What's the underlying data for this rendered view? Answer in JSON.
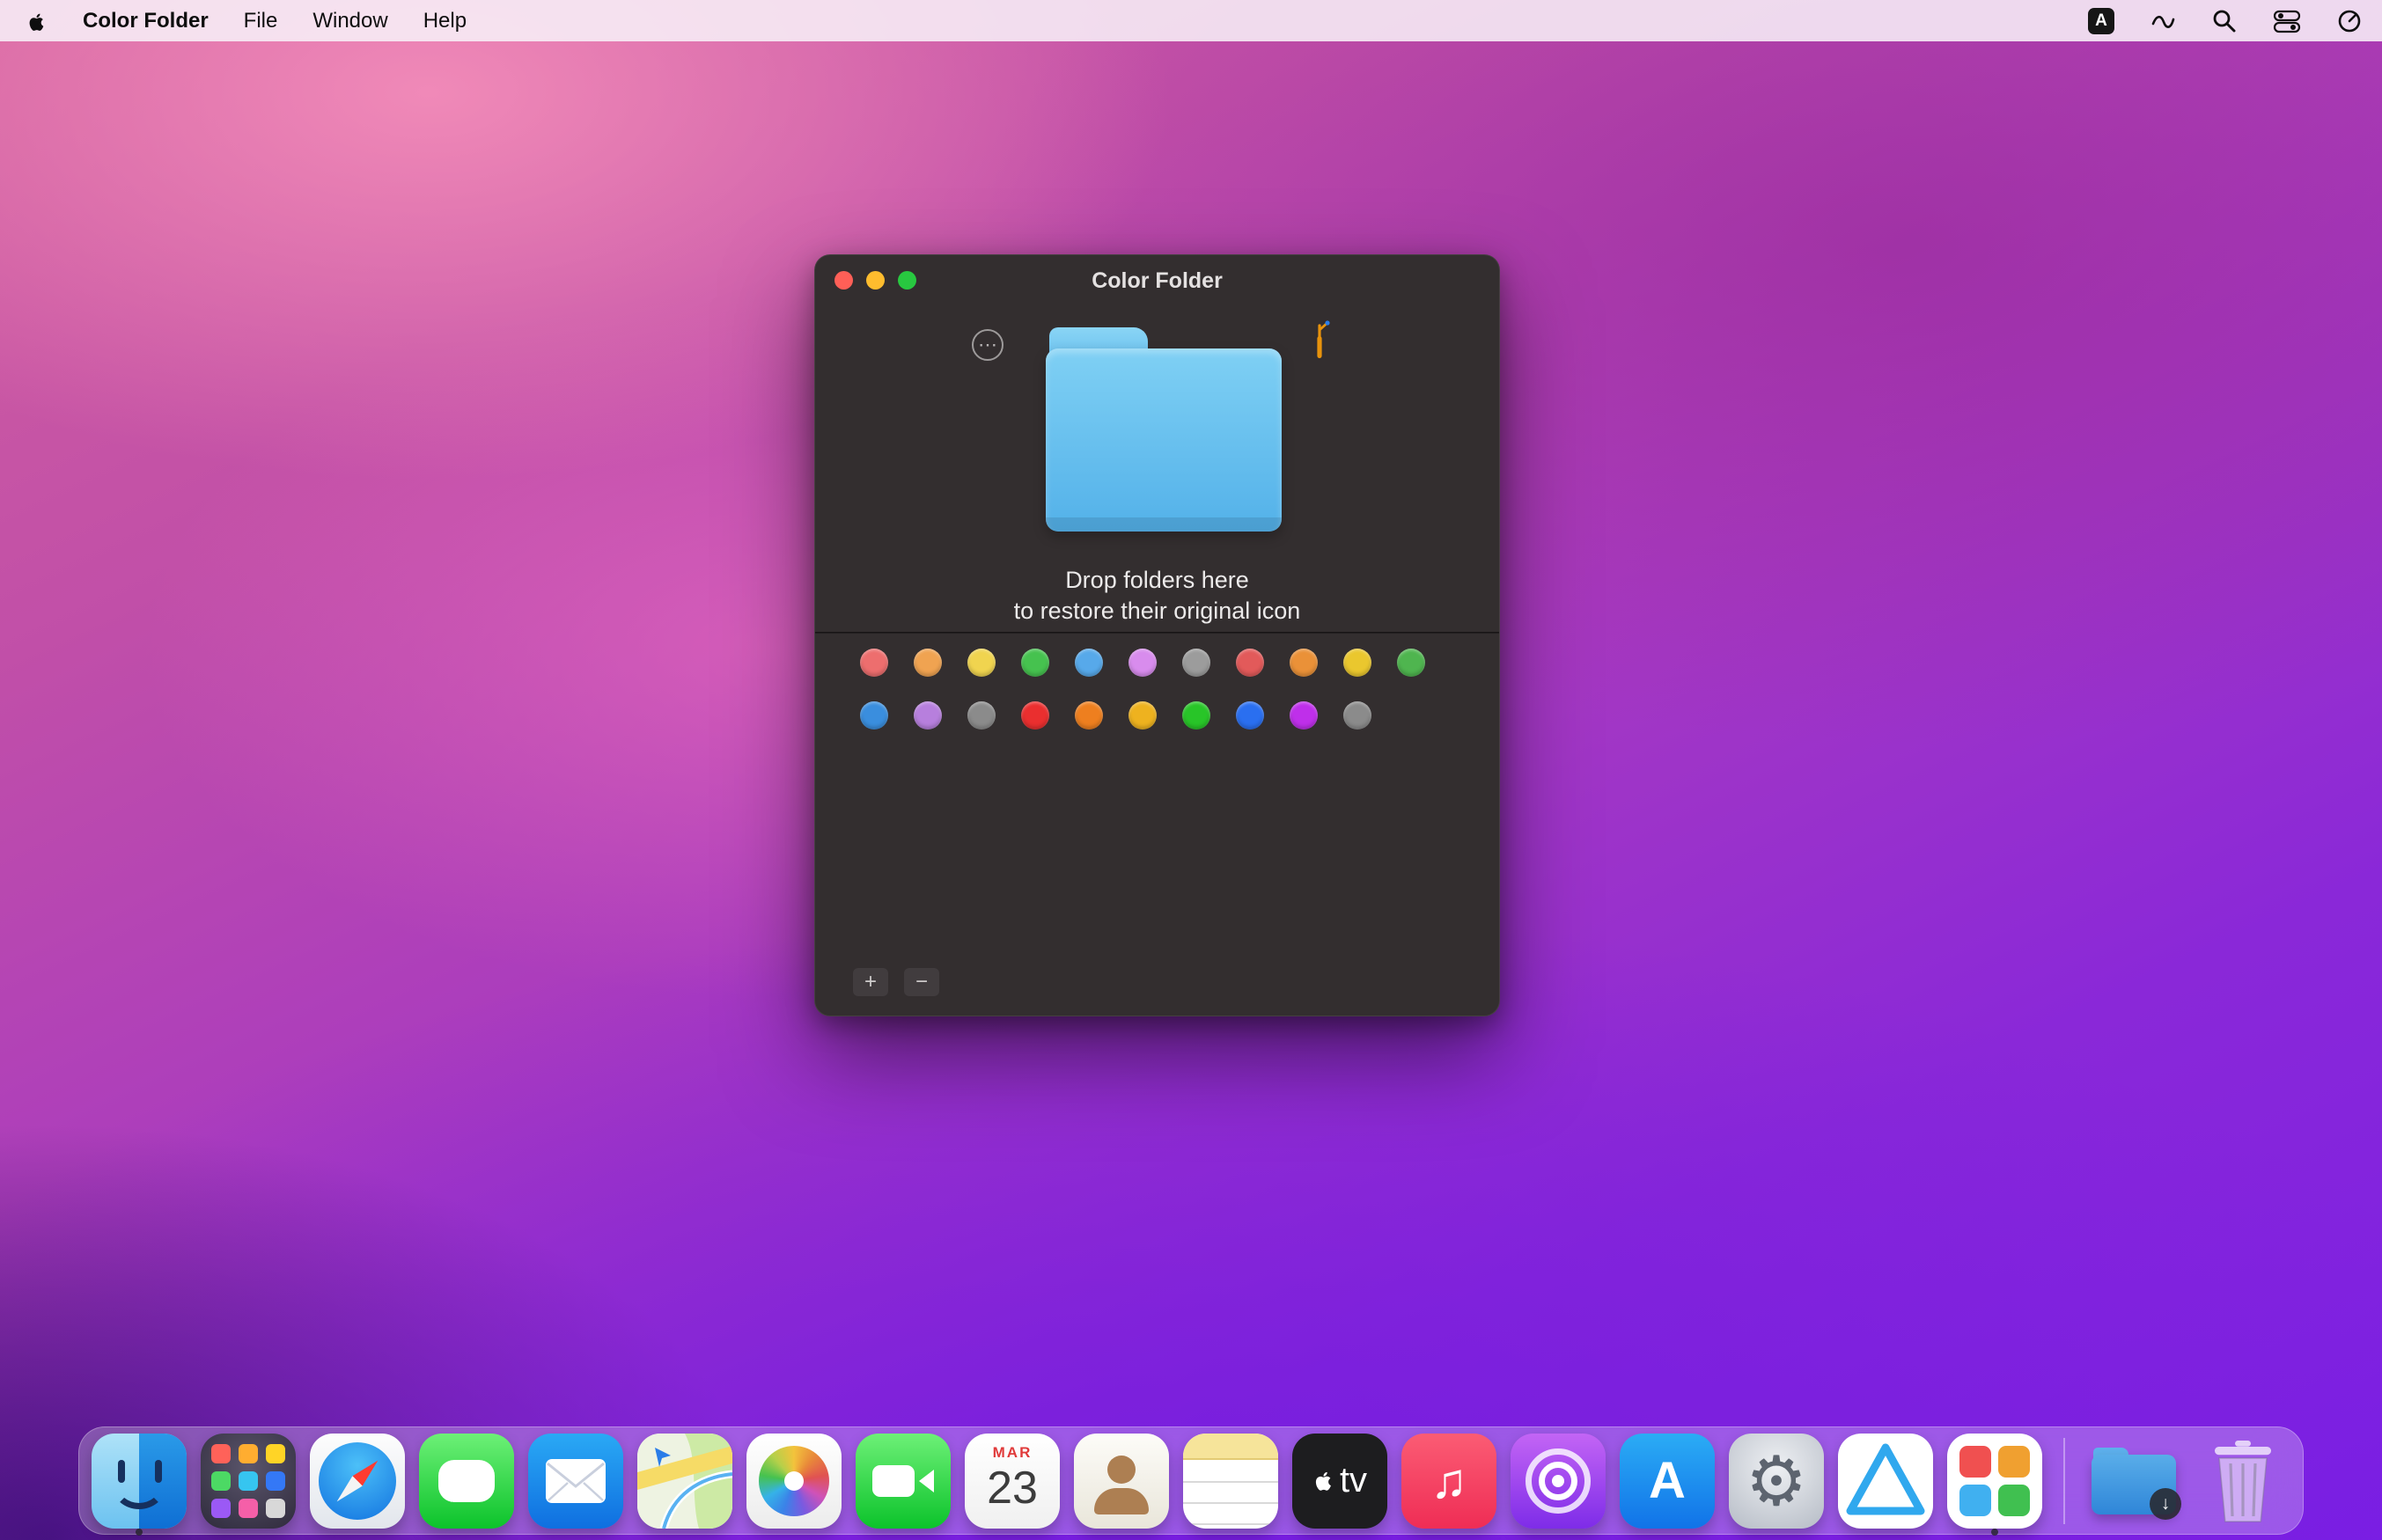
{
  "menubar": {
    "app_name": "Color Folder",
    "items": [
      "File",
      "Window",
      "Help"
    ],
    "input_badge": "A",
    "right_icons": [
      "keyboard-input-source",
      "wave",
      "spotlight-search",
      "control-center",
      "status-circle"
    ]
  },
  "window": {
    "title": "Color Folder",
    "ellipsis_glyph": "⋯",
    "drop_line1": "Drop folders here",
    "drop_line2": "to restore their original icon",
    "add_label": "+",
    "remove_label": "−"
  },
  "swatches": {
    "row1": [
      "#ed6e6e",
      "#f0a351",
      "#f0d44f",
      "#46c24f",
      "#57a9ea",
      "#d88ced",
      "#9c9c9c",
      "#e25a5a",
      "#ea9138",
      "#eac72e",
      "#4fb54f"
    ],
    "row2": [
      "#3a8ede",
      "#b77fdd",
      "#8b8b8b",
      "#ea2f2f",
      "#ee7f1f",
      "#eeb21f",
      "#28c528",
      "#2a6ff0",
      "#bf2fea",
      "#8b8b8b"
    ]
  },
  "dock": {
    "items": [
      "finder",
      "launchpad",
      "safari",
      "messages",
      "mail",
      "maps",
      "photos",
      "facetime",
      "calendar",
      "contacts",
      "notes",
      "appletv",
      "music",
      "podcasts",
      "appstore",
      "system-preferences",
      "triangle-app",
      "colors-app",
      "downloads",
      "trash"
    ],
    "running_apps": [
      "finder",
      "colors-app"
    ],
    "calendar_month": "MAR",
    "calendar_day": "23",
    "appletv_label": "tv",
    "appstore_glyph": "A",
    "music_glyph": "♫",
    "settings_glyph": "⚙",
    "downloads_glyph": "↓"
  },
  "colors": {
    "tl-red": "#ff5f57",
    "tl-yellow": "#febc2e",
    "tl-green": "#28c840",
    "folder-top": "#7fd0f4",
    "folder-bottom": "#53b1e9",
    "window-bg": "#332e2f"
  }
}
